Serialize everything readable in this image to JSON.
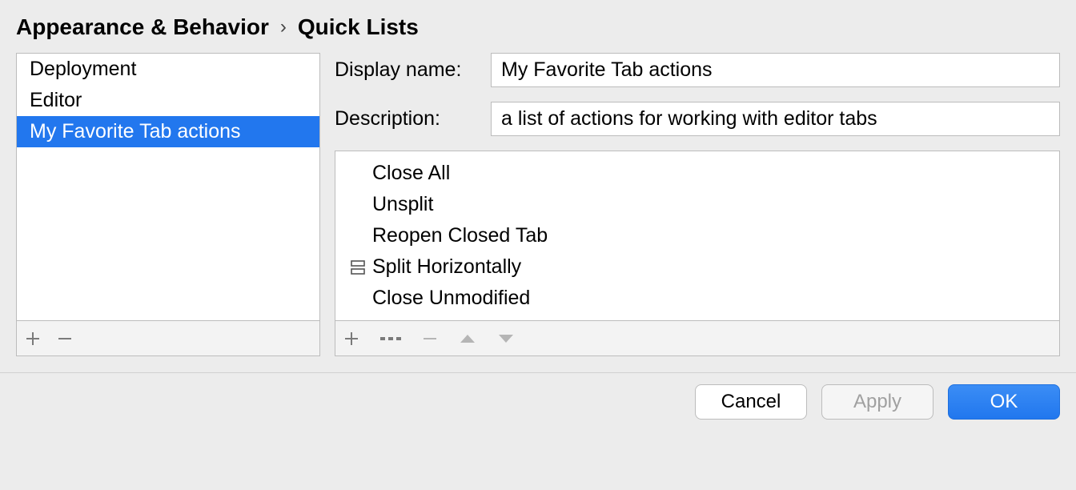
{
  "breadcrumb": {
    "parent": "Appearance & Behavior",
    "current": "Quick Lists"
  },
  "quickLists": {
    "items": [
      {
        "label": "Deployment",
        "selected": false
      },
      {
        "label": "Editor",
        "selected": false
      },
      {
        "label": "My Favorite Tab actions",
        "selected": true
      }
    ]
  },
  "form": {
    "displayNameLabel": "Display name:",
    "displayNameValue": "My Favorite Tab actions",
    "descriptionLabel": "Description:",
    "descriptionValue": "a list of actions for working with editor tabs"
  },
  "actions": [
    {
      "icon": "",
      "label": "Close All"
    },
    {
      "icon": "",
      "label": "Unsplit"
    },
    {
      "icon": "",
      "label": "Reopen Closed Tab"
    },
    {
      "icon": "split-horizontal-icon",
      "label": "Split Horizontally"
    },
    {
      "icon": "",
      "label": "Close Unmodified"
    }
  ],
  "buttons": {
    "cancel": "Cancel",
    "apply": "Apply",
    "ok": "OK"
  }
}
